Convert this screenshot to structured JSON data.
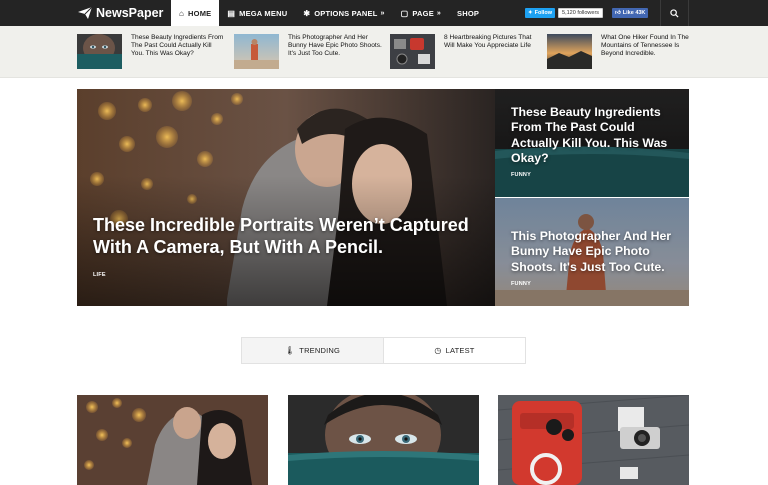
{
  "header": {
    "logo_text": "NewsPaper",
    "nav": [
      {
        "label": "HOME",
        "icon": "home-icon",
        "active": true
      },
      {
        "label": "MEGA MENU",
        "icon": "menu-icon"
      },
      {
        "label": "OPTIONS PANEL",
        "icon": "gear-icon",
        "has_chevron": true
      },
      {
        "label": "PAGE",
        "icon": "page-icon",
        "has_chevron": true
      },
      {
        "label": "SHOP"
      }
    ],
    "twitter_label": "Follow",
    "twitter_count": "5,120 followers",
    "facebook_label": "Like 43K",
    "search_icon": "search-icon"
  },
  "ticker": [
    {
      "title": "These Beauty Ingredients From The Past Could Actually Kill You. This Was Okay?"
    },
    {
      "title": "This Photographer And Her Bunny Have Epic Photo Shoots. It's Just Too Cute."
    },
    {
      "title": "8 Heartbreaking Pictures That Will Make You Appreciate Life"
    },
    {
      "title": "What One Hiker Found In The Mountains of Tennessee Is Beyond Incredible."
    }
  ],
  "hero": {
    "main": {
      "title": "These Incredible Portraits Weren’t Captured With A Camera, But With A Pencil.",
      "category": "LIFE"
    },
    "side": [
      {
        "title": "These Beauty Ingredients From The Past Could Actually Kill You. This Was Okay?",
        "category": "FUNNY"
      },
      {
        "title": "This Photographer And Her Bunny Have Epic Photo Shoots. It's Just Too Cute.",
        "category": "FUNNY"
      }
    ]
  },
  "tabs": [
    {
      "label": "TRENDING",
      "icon": "flame-icon",
      "active": true
    },
    {
      "label": "LATEST",
      "icon": "clock-icon"
    }
  ],
  "colors": {
    "topbar": "#242424",
    "ticker_bg": "#f0f0ec",
    "twitter": "#1da1f2",
    "facebook": "#4267b2"
  }
}
